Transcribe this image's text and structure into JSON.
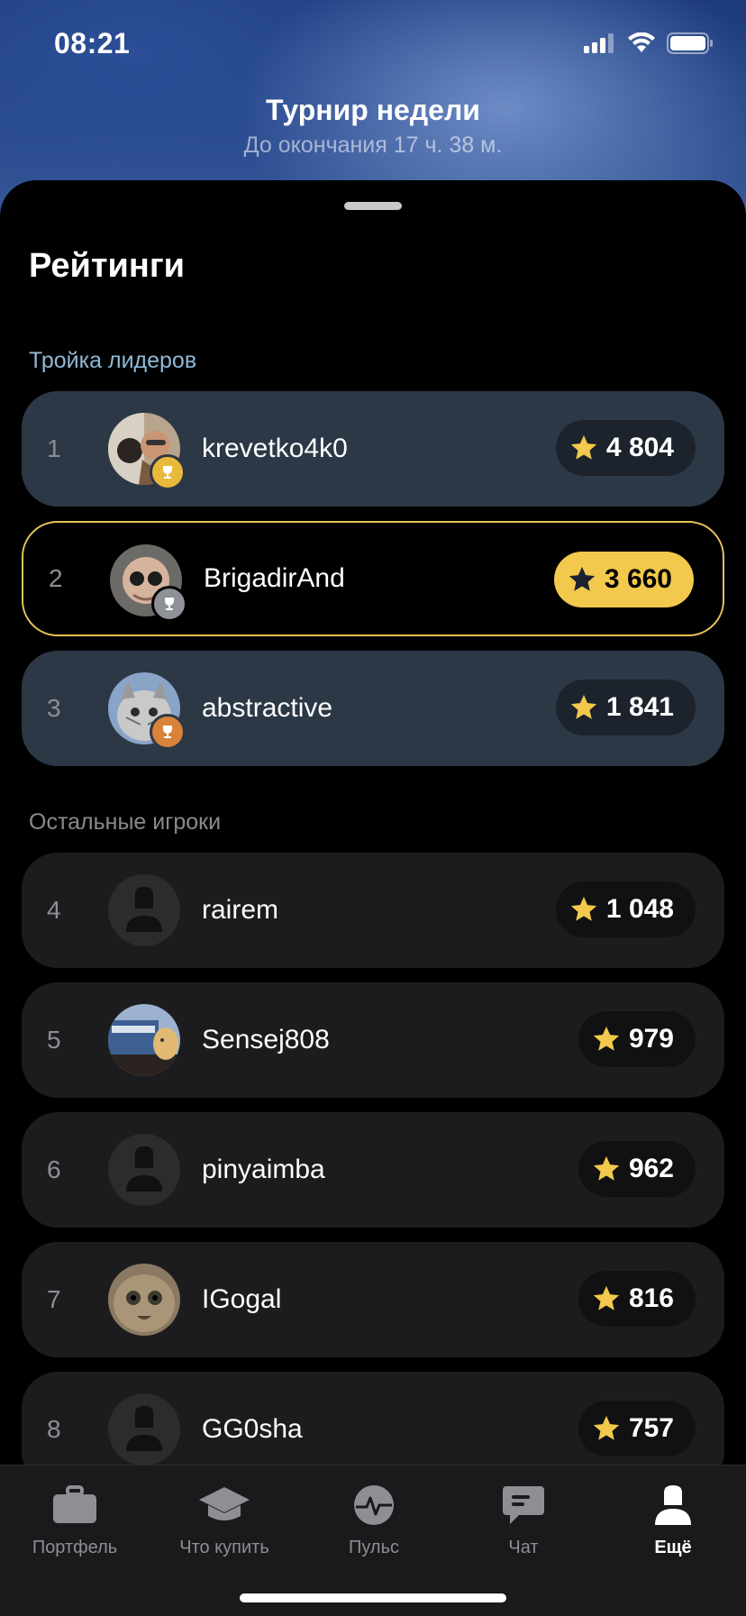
{
  "status_bar": {
    "time": "08:21"
  },
  "header": {
    "title": "Турнир недели",
    "subtitle": "До окончания 17 ч. 38 м."
  },
  "page_title": "Рейтинги",
  "top_section_label": "Тройка лидеров",
  "rest_section_label": "Остальные игроки",
  "colors": {
    "accent": "#f2c94c",
    "top_row_bg": "#2c3846",
    "row_bg": "#1c1c1e"
  },
  "leaders": [
    {
      "rank": "1",
      "name": "krevetko4k0",
      "score": "4 804",
      "trophy": "gold-trophy-icon"
    },
    {
      "rank": "2",
      "name": "BrigadirAnd",
      "score": "3 660",
      "trophy": "silver-trophy-icon",
      "current_user": true
    },
    {
      "rank": "3",
      "name": "abstractive",
      "score": "1 841",
      "trophy": "bronze-trophy-icon"
    }
  ],
  "players": [
    {
      "rank": "4",
      "name": "rairem",
      "score": "1 048",
      "avatar": "placeholder-avatar"
    },
    {
      "rank": "5",
      "name": "Sensej808",
      "score": "979",
      "avatar": "photo-avatar"
    },
    {
      "rank": "6",
      "name": "pinyaimba",
      "score": "962",
      "avatar": "placeholder-avatar"
    },
    {
      "rank": "7",
      "name": "IGogal",
      "score": "816",
      "avatar": "photo-avatar"
    },
    {
      "rank": "8",
      "name": "GG0sha",
      "score": "757",
      "avatar": "placeholder-avatar"
    }
  ],
  "tabs": [
    {
      "label": "Портфель",
      "icon": "briefcase-icon"
    },
    {
      "label": "Что купить",
      "icon": "graduation-cap-icon"
    },
    {
      "label": "Пульс",
      "icon": "pulse-icon"
    },
    {
      "label": "Чат",
      "icon": "chat-icon"
    },
    {
      "label": "Ещё",
      "icon": "profile-icon",
      "active": true
    }
  ]
}
